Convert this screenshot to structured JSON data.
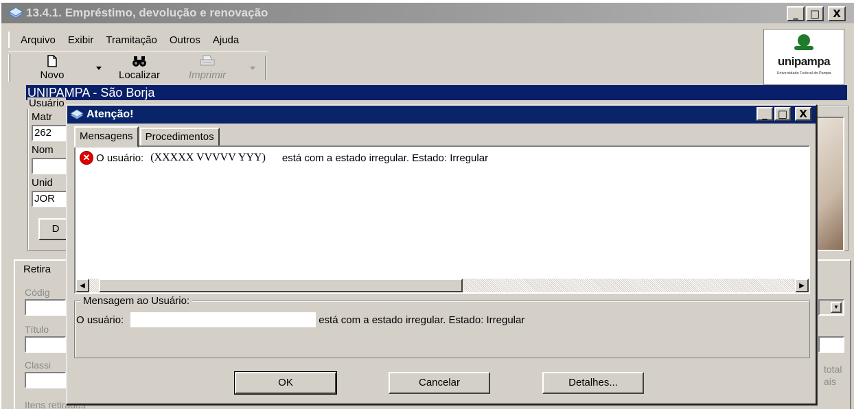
{
  "main_window": {
    "title": "13.4.1. Empréstimo, devolução e renovação",
    "controls": {
      "minimize": "_",
      "maximize": "□",
      "close": "X"
    }
  },
  "menu": [
    "Arquivo",
    "Exibir",
    "Tramitação",
    "Outros",
    "Ajuda"
  ],
  "toolbar": {
    "novo": "Novo",
    "localizar": "Localizar",
    "imprimir": "Imprimir"
  },
  "logo": {
    "name": "unipampa",
    "subtitle": "Universidade Federal do Pampa"
  },
  "unit_bar": "UNIPAMPA - São Borja",
  "usuario_group": {
    "legend": "Usuário",
    "matricula_label": "Matr",
    "matricula_value": "262",
    "nome_label": "Nom",
    "unidade_label": "Unid",
    "unidade_value": "JOR",
    "button_label": "D"
  },
  "background_panel": {
    "tab_label": "Retira",
    "codigo_label": "Códig",
    "titulo_label": "Título",
    "classificacao_label": "Classi",
    "itens_label": "Itens retirados",
    "total_label": "total",
    "tais_label": "ais"
  },
  "dialog": {
    "title": "Atenção!",
    "tabs": [
      "Mensagens",
      "Procedimentos"
    ],
    "message_prefix": "O usuário:",
    "message_name": "(XXXXX VVVVV YYY)",
    "message_suffix": "está com a estado irregular. Estado: Irregular",
    "user_message_legend": "Mensagem ao Usuário:",
    "user_message_prefix": "O usuário:",
    "user_message_suffix": "está com a estado irregular. Estado: Irregular",
    "buttons": {
      "ok": "OK",
      "cancel": "Cancelar",
      "details": "Detalhes..."
    }
  },
  "colors": {
    "dialog_title_bg": "#0a246a",
    "unit_bar_bg": "#0a1f6a",
    "window_bg": "#d4d0c8",
    "error_icon": "#e00000"
  }
}
